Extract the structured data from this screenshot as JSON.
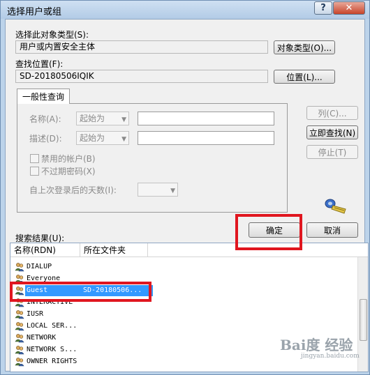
{
  "window": {
    "title": "选择用户或组",
    "help": "?",
    "close": "✕"
  },
  "object_type": {
    "label": "选择此对象类型(S):",
    "value": "用户或内置安全主体",
    "button": "对象类型(O)..."
  },
  "location": {
    "label": "查找位置(F):",
    "value": "SD-20180506IQIK",
    "button": "位置(L)..."
  },
  "query": {
    "tab": "一般性查询",
    "name_label": "名称(A):",
    "desc_label": "描述(D):",
    "starts_with": "起始为",
    "disabled_accounts": "禁用的帐户(B)",
    "no_expire_pwd": "不过期密码(X)",
    "days_since_login": "自上次登录后的天数(I):"
  },
  "right_buttons": {
    "columns": "列(C)...",
    "find_now": "立即查找(N)",
    "stop": "停止(T)"
  },
  "actions": {
    "ok": "确定",
    "cancel": "取消"
  },
  "results": {
    "label": "搜索结果(U):",
    "col_name": "名称(RDN)",
    "col_folder": "所在文件夹",
    "rows": [
      {
        "name": "DIALUP",
        "folder": ""
      },
      {
        "name": "Everyone",
        "folder": ""
      },
      {
        "name": "Guest",
        "folder": "SD-20180506..."
      },
      {
        "name": "INTERACTIVE",
        "folder": ""
      },
      {
        "name": "IUSR",
        "folder": ""
      },
      {
        "name": "LOCAL SER...",
        "folder": ""
      },
      {
        "name": "NETWORK",
        "folder": ""
      },
      {
        "name": "NETWORK S...",
        "folder": ""
      },
      {
        "name": "OWNER RIGHTS",
        "folder": ""
      }
    ]
  },
  "watermark": {
    "brand": "Bai度 经验",
    "url": "jingyan.baidu.com"
  }
}
